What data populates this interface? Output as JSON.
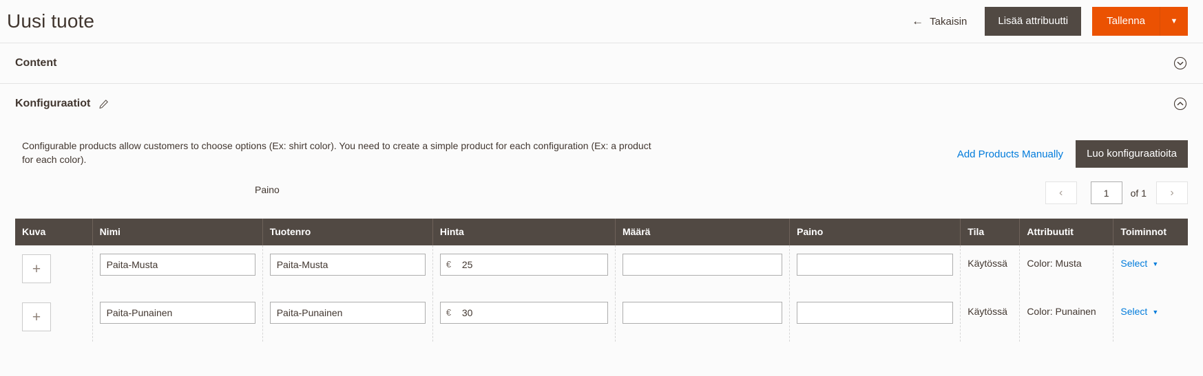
{
  "header": {
    "title": "Uusi tuote",
    "back_label": "Takaisin",
    "back_icon": "arrow-left-icon",
    "add_attribute_label": "Lisää attribuutti",
    "save_label": "Tallenna",
    "save_caret_icon": "chevron-down-icon",
    "accent_color": "#eb5202",
    "secondary_color": "#514943"
  },
  "sections": [
    {
      "title": "Content",
      "toggle_icon": "chevron-down-circle-icon",
      "expanded": false
    },
    {
      "title": "Konfiguraatiot",
      "edit_icon": "pencil-icon",
      "toggle_icon": "chevron-up-circle-icon",
      "expanded": true
    }
  ],
  "configurations": {
    "description": "Configurable products allow customers to choose options (Ex: shirt color). You need to create a simple product for each configuration (Ex: a product for each color).",
    "add_manually_label": "Add Products Manually",
    "create_configurations_label": "Luo konfiguraatioita",
    "grid_label": "Paino",
    "pagination": {
      "prev_icon": "chevron-left-icon",
      "next_icon": "chevron-right-icon",
      "page_value": "1",
      "of_label": "of 1"
    },
    "columns": [
      "Kuva",
      "Nimi",
      "Tuotenro",
      "Hinta",
      "Määrä",
      "Paino",
      "Tila",
      "Attribuutit",
      "Toiminnot"
    ],
    "currency_symbol": "€",
    "thumb_icon": "plus-icon",
    "rows": [
      {
        "name": "Paita-Musta",
        "sku": "Paita-Musta",
        "price": "25",
        "quantity": "",
        "weight": "",
        "status": "Käytössä",
        "attributes": "Color: Musta",
        "action_label": "Select",
        "action_caret_icon": "caret-down-icon"
      },
      {
        "name": "Paita-Punainen",
        "sku": "Paita-Punainen",
        "price": "30",
        "quantity": "",
        "weight": "",
        "status": "Käytössä",
        "attributes": "Color: Punainen",
        "action_label": "Select",
        "action_caret_icon": "caret-down-icon"
      }
    ]
  }
}
